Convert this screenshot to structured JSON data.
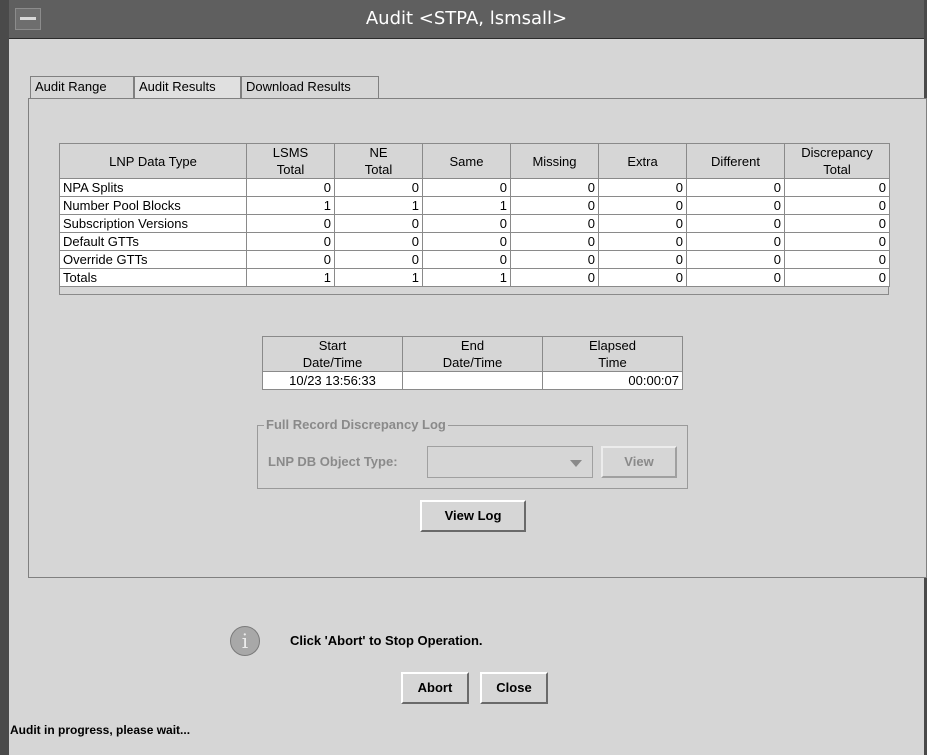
{
  "window": {
    "title": "Audit <STPA, lsmsall>"
  },
  "tabs": [
    {
      "label": "Audit Range"
    },
    {
      "label": "Audit Results"
    },
    {
      "label": "Download Results"
    }
  ],
  "results_table": {
    "headers": [
      {
        "line1": "",
        "line2": "LNP Data Type"
      },
      {
        "line1": "LSMS",
        "line2": "Total"
      },
      {
        "line1": "NE",
        "line2": "Total"
      },
      {
        "line1": "",
        "line2": "Same"
      },
      {
        "line1": "",
        "line2": "Missing"
      },
      {
        "line1": "",
        "line2": "Extra"
      },
      {
        "line1": "",
        "line2": "Different"
      },
      {
        "line1": "Discrepancy",
        "line2": "Total"
      }
    ],
    "rows": [
      {
        "type": "NPA Splits",
        "lsms": "0",
        "ne": "0",
        "same": "0",
        "missing": "0",
        "extra": "0",
        "different": "0",
        "disc": "0"
      },
      {
        "type": "Number Pool Blocks",
        "lsms": "1",
        "ne": "1",
        "same": "1",
        "missing": "0",
        "extra": "0",
        "different": "0",
        "disc": "0"
      },
      {
        "type": "Subscription Versions",
        "lsms": "0",
        "ne": "0",
        "same": "0",
        "missing": "0",
        "extra": "0",
        "different": "0",
        "disc": "0"
      },
      {
        "type": "Default GTTs",
        "lsms": "0",
        "ne": "0",
        "same": "0",
        "missing": "0",
        "extra": "0",
        "different": "0",
        "disc": "0"
      },
      {
        "type": "Override GTTs",
        "lsms": "0",
        "ne": "0",
        "same": "0",
        "missing": "0",
        "extra": "0",
        "different": "0",
        "disc": "0"
      },
      {
        "type": "Totals",
        "lsms": "1",
        "ne": "1",
        "same": "1",
        "missing": "0",
        "extra": "0",
        "different": "0",
        "disc": "0"
      }
    ]
  },
  "time_table": {
    "headers": [
      {
        "line1": "Start",
        "line2": "Date/Time"
      },
      {
        "line1": "End",
        "line2": "Date/Time"
      },
      {
        "line1": "Elapsed",
        "line2": "Time"
      }
    ],
    "values": {
      "start": "10/23 13:56:33",
      "end": "",
      "elapsed": "00:00:07"
    }
  },
  "discrepancy_log": {
    "legend": "Full Record Discrepancy Log",
    "object_type_label": "LNP DB Object Type:",
    "object_type_value": "",
    "view_label": "View"
  },
  "view_log_label": "View Log",
  "info": {
    "icon": "info-icon",
    "message": "Click 'Abort' to Stop Operation."
  },
  "buttons": {
    "abort": "Abort",
    "close": "Close"
  },
  "status": "Audit in progress, please wait..."
}
